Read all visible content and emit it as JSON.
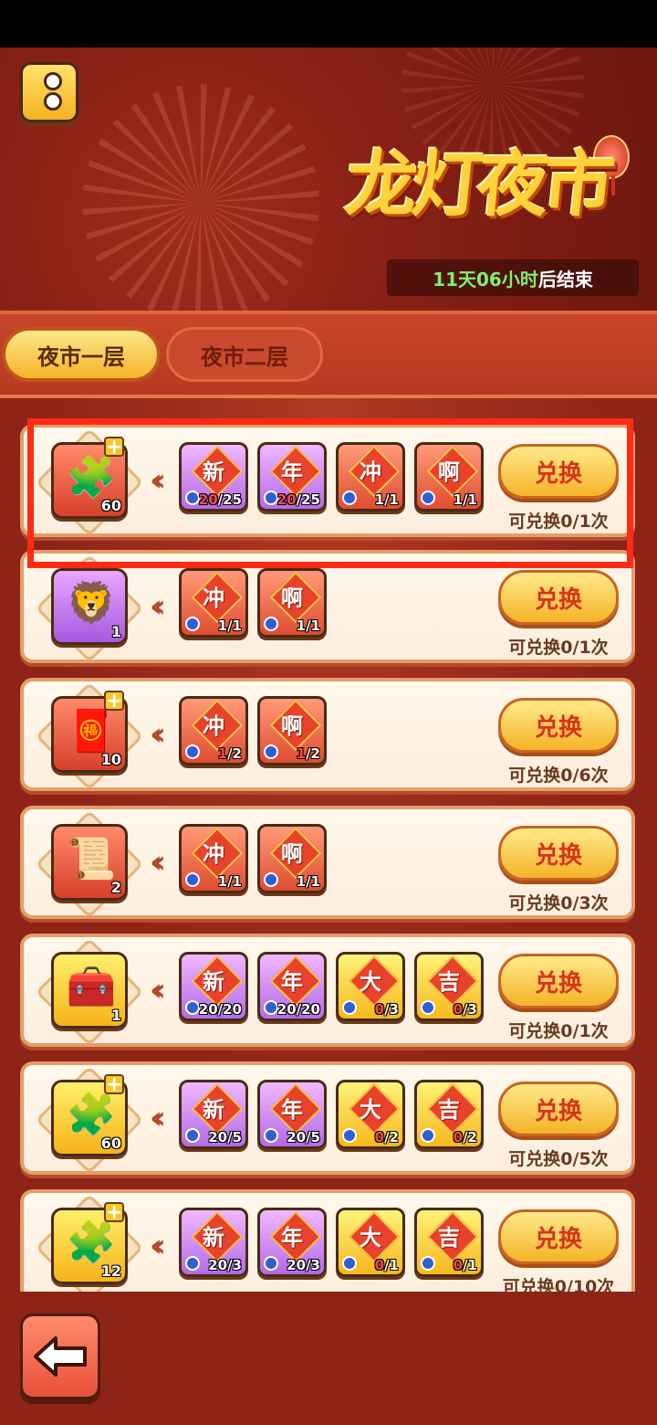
{
  "header": {
    "title": "龙灯夜市",
    "timer_highlight": "11天06小时",
    "timer_suffix": "后结束"
  },
  "tabs": [
    {
      "label": "夜市一层",
      "active": true
    },
    {
      "label": "夜市二层",
      "active": false
    }
  ],
  "rows": [
    {
      "reward": {
        "icon": "gold-puzzle-piece-icon",
        "count": "60",
        "color": "red"
      },
      "requirements": [
        {
          "char": "新",
          "progress_have": "20",
          "progress_need": "/25",
          "insufficient": true,
          "color": "purple"
        },
        {
          "char": "年",
          "progress_have": "20",
          "progress_need": "/25",
          "insufficient": true,
          "color": "purple"
        },
        {
          "char": "冲",
          "progress_have": "1",
          "progress_need": "/1",
          "insufficient": false,
          "color": "red"
        },
        {
          "char": "啊",
          "progress_have": "1",
          "progress_need": "/1",
          "insufficient": false,
          "color": "red"
        }
      ],
      "button_label": "兑换",
      "limit": "可兑换0/1次"
    },
    {
      "reward": {
        "icon": "lion-dance-frame-icon",
        "count": "1",
        "color": "purple"
      },
      "requirements": [
        {
          "char": "冲",
          "progress_have": "1",
          "progress_need": "/1",
          "insufficient": false,
          "color": "red"
        },
        {
          "char": "啊",
          "progress_have": "1",
          "progress_need": "/1",
          "insufficient": false,
          "color": "red"
        }
      ],
      "button_label": "兑换",
      "limit": "可兑换0/1次"
    },
    {
      "reward": {
        "icon": "red-puzzle-bottle-icon",
        "count": "10",
        "color": "red"
      },
      "requirements": [
        {
          "char": "冲",
          "progress_have": "1",
          "progress_need": "/2",
          "insufficient": true,
          "color": "red"
        },
        {
          "char": "啊",
          "progress_have": "1",
          "progress_need": "/2",
          "insufficient": true,
          "color": "red"
        }
      ],
      "button_label": "兑换",
      "limit": "可兑换0/6次"
    },
    {
      "reward": {
        "icon": "purple-scroll-icon",
        "count": "2",
        "color": "red"
      },
      "requirements": [
        {
          "char": "冲",
          "progress_have": "1",
          "progress_need": "/1",
          "insufficient": false,
          "color": "red"
        },
        {
          "char": "啊",
          "progress_have": "1",
          "progress_need": "/1",
          "insufficient": false,
          "color": "red"
        }
      ],
      "button_label": "兑换",
      "limit": "可兑换0/3次"
    },
    {
      "reward": {
        "icon": "treasure-chest-icon",
        "count": "1",
        "color": "gold"
      },
      "requirements": [
        {
          "char": "新",
          "progress_have": "20",
          "progress_need": "/20",
          "insufficient": false,
          "color": "purple"
        },
        {
          "char": "年",
          "progress_have": "20",
          "progress_need": "/20",
          "insufficient": false,
          "color": "purple"
        },
        {
          "char": "大",
          "progress_have": "0",
          "progress_need": "/3",
          "insufficient": true,
          "color": "gold"
        },
        {
          "char": "吉",
          "progress_have": "0",
          "progress_need": "/3",
          "insufficient": true,
          "color": "gold"
        }
      ],
      "button_label": "兑换",
      "limit": "可兑换0/1次"
    },
    {
      "reward": {
        "icon": "gold-puzzle-piece-icon",
        "count": "60",
        "color": "gold"
      },
      "requirements": [
        {
          "char": "新",
          "progress_have": "20",
          "progress_need": "/5",
          "insufficient": false,
          "color": "purple"
        },
        {
          "char": "年",
          "progress_have": "20",
          "progress_need": "/5",
          "insufficient": false,
          "color": "purple"
        },
        {
          "char": "大",
          "progress_have": "0",
          "progress_need": "/2",
          "insufficient": true,
          "color": "gold"
        },
        {
          "char": "吉",
          "progress_have": "0",
          "progress_need": "/2",
          "insufficient": true,
          "color": "gold"
        }
      ],
      "button_label": "兑换",
      "limit": "可兑换0/5次"
    },
    {
      "reward": {
        "icon": "purple-puzzle-piece-icon",
        "count": "12",
        "color": "gold"
      },
      "requirements": [
        {
          "char": "新",
          "progress_have": "20",
          "progress_need": "/3",
          "insufficient": false,
          "color": "purple"
        },
        {
          "char": "年",
          "progress_have": "20",
          "progress_need": "/3",
          "insufficient": false,
          "color": "purple"
        },
        {
          "char": "大",
          "progress_have": "0",
          "progress_need": "/1",
          "insufficient": true,
          "color": "gold"
        },
        {
          "char": "吉",
          "progress_have": "0",
          "progress_need": "/1",
          "insufficient": true,
          "color": "gold"
        }
      ],
      "button_label": "兑换",
      "limit": "可兑换0/10次"
    }
  ],
  "icons": {
    "info": "info-icon",
    "back": "back-arrow-icon",
    "arrow": "double-chevron-left-icon",
    "clock": "clock-icon"
  },
  "colors": {
    "background": "#8e2418",
    "accent_gold": "#f4b42a",
    "button_text": "#d8321c",
    "timer_green": "#7ef06a",
    "highlight_box": "#ff2a14"
  }
}
